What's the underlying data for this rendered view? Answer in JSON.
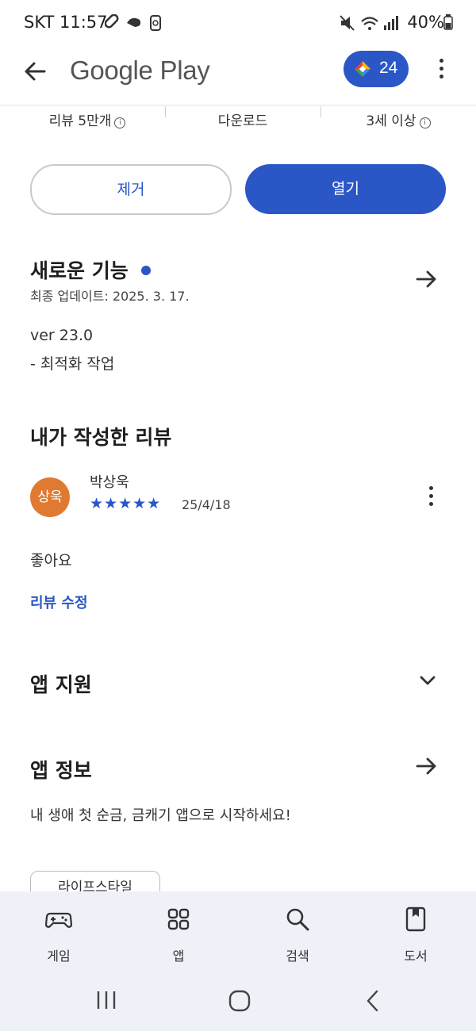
{
  "status_bar": {
    "carrier_time": "SKT 11:57",
    "battery": "40%"
  },
  "app_bar": {
    "title": "Google Play",
    "points": "24"
  },
  "stats": {
    "reviews": "리뷰 5만개",
    "downloads": "다운로드",
    "age_rating": "3세 이상"
  },
  "actions": {
    "uninstall": "제거",
    "open": "열기"
  },
  "whats_new": {
    "title": "새로운 기능",
    "last_updated": "최종 업데이트: 2025. 3. 17.",
    "version": "ver 23.0",
    "note": "- 최적화 작업"
  },
  "my_review": {
    "section_title": "내가 작성한 리뷰",
    "avatar_text": "상욱",
    "author": "박상욱",
    "stars": "★★★★★",
    "rating": 5,
    "date": "25/4/18",
    "text": "좋아요",
    "edit_link": "리뷰 수정"
  },
  "app_support": {
    "title": "앱 지원"
  },
  "app_info": {
    "title": "앱 정보",
    "description": "내 생애 첫 순금, 금캐기 앱으로 시작하세요!",
    "chip": "라이프스타일"
  },
  "bottom_nav": {
    "items": [
      {
        "label": "게임",
        "icon": "gamepad-icon"
      },
      {
        "label": "앱",
        "icon": "apps-grid-icon"
      },
      {
        "label": "검색",
        "icon": "search-icon"
      },
      {
        "label": "도서",
        "icon": "book-icon"
      }
    ]
  },
  "colors": {
    "accent": "#2a56c6",
    "avatar": "#e07a32",
    "nav_bg": "#eef1f8"
  }
}
